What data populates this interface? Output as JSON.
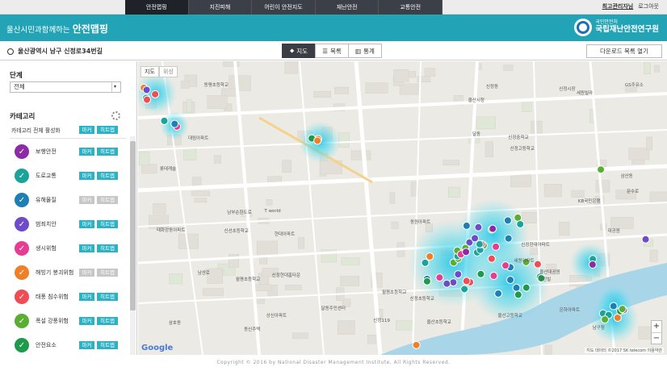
{
  "nav": {
    "tabs": [
      "안전맵핑",
      "지진피해",
      "어린이 안전지도",
      "재난안전",
      "교통안전"
    ],
    "active": 0,
    "links": [
      "최고관리자님",
      "로그아웃"
    ]
  },
  "header": {
    "title_prefix": "울산시민과함께하는",
    "title_main": "안전맵핑",
    "org_small": "국민안전처",
    "org_name": "국립재난안전연구원"
  },
  "toolbar": {
    "address": "울산광역시 남구 신정로34번길",
    "tabs": [
      {
        "label": "지도",
        "icon": "map-pin-icon",
        "active": true
      },
      {
        "label": "목록",
        "icon": "list-icon",
        "active": false
      },
      {
        "label": "통계",
        "icon": "bar-chart-icon",
        "active": false
      }
    ],
    "download_label": "다운로드 목록 열기"
  },
  "sidebar": {
    "stage_title": "단계",
    "stage_value": "전체",
    "category_title": "카테고리",
    "all_label": "카테고리 전체 활성화",
    "marker_label": "마커",
    "heatmap_label": "히트맵",
    "categories": [
      {
        "label": "보행안전",
        "color": "#8e2aa6",
        "marker": true,
        "heat": true
      },
      {
        "label": "도로교통",
        "color": "#1aa39a",
        "marker": true,
        "heat": true
      },
      {
        "label": "유해물질",
        "color": "#1d7fb3",
        "marker": false,
        "heat": false
      },
      {
        "label": "범죄치안",
        "color": "#6e4bc8",
        "marker": true,
        "heat": true
      },
      {
        "label": "생시위험",
        "color": "#e53d93",
        "marker": true,
        "heat": true
      },
      {
        "label": "해빙기 붕괴위험",
        "color": "#f07f2a",
        "marker": false,
        "heat": false
      },
      {
        "label": "태풍 침수위험",
        "color": "#ef4c53",
        "marker": true,
        "heat": true
      },
      {
        "label": "폭설 강풍위험",
        "color": "#5aae32",
        "marker": true,
        "heat": true
      },
      {
        "label": "안전요소",
        "color": "#1f9a4c",
        "marker": true,
        "heat": true
      }
    ]
  },
  "map": {
    "toggle": [
      "지도",
      "위성"
    ],
    "zoom_in": "+",
    "zoom_out": "−",
    "logo": "Google",
    "copyright": "지도 데이터 ©2017 SK telecom   이용약관",
    "labels": [
      "월평초등학교",
      "울산초등학교",
      "은하아파트",
      "그린빌",
      "T world",
      "GS주유소",
      "신정119",
      "울산시청",
      "태화강동아파트",
      "신정현대아파트",
      "동신주택",
      "상신아파트",
      "대림아파트",
      "남부순환도로",
      "롯데캐슬",
      "신정동",
      "세원빌라",
      "달동",
      "삼산동",
      "울산고등학교",
      "신정초등학교",
      "현대아파트",
      "문수로",
      "대공원",
      "신정시장",
      "삼호동",
      "신정현대홈타운",
      "동평초등학교",
      "월평초등학교",
      "세원아파트",
      "달동주민센터",
      "신정고등학교",
      "울산대공원",
      "남구청",
      "남산로",
      "신정중학교",
      "신선초등학교",
      "동원아파트",
      "KB국민은행"
    ]
  },
  "footer": "Copyright © 2016 by National Disaster Management Institute, All Rights Reserved."
}
